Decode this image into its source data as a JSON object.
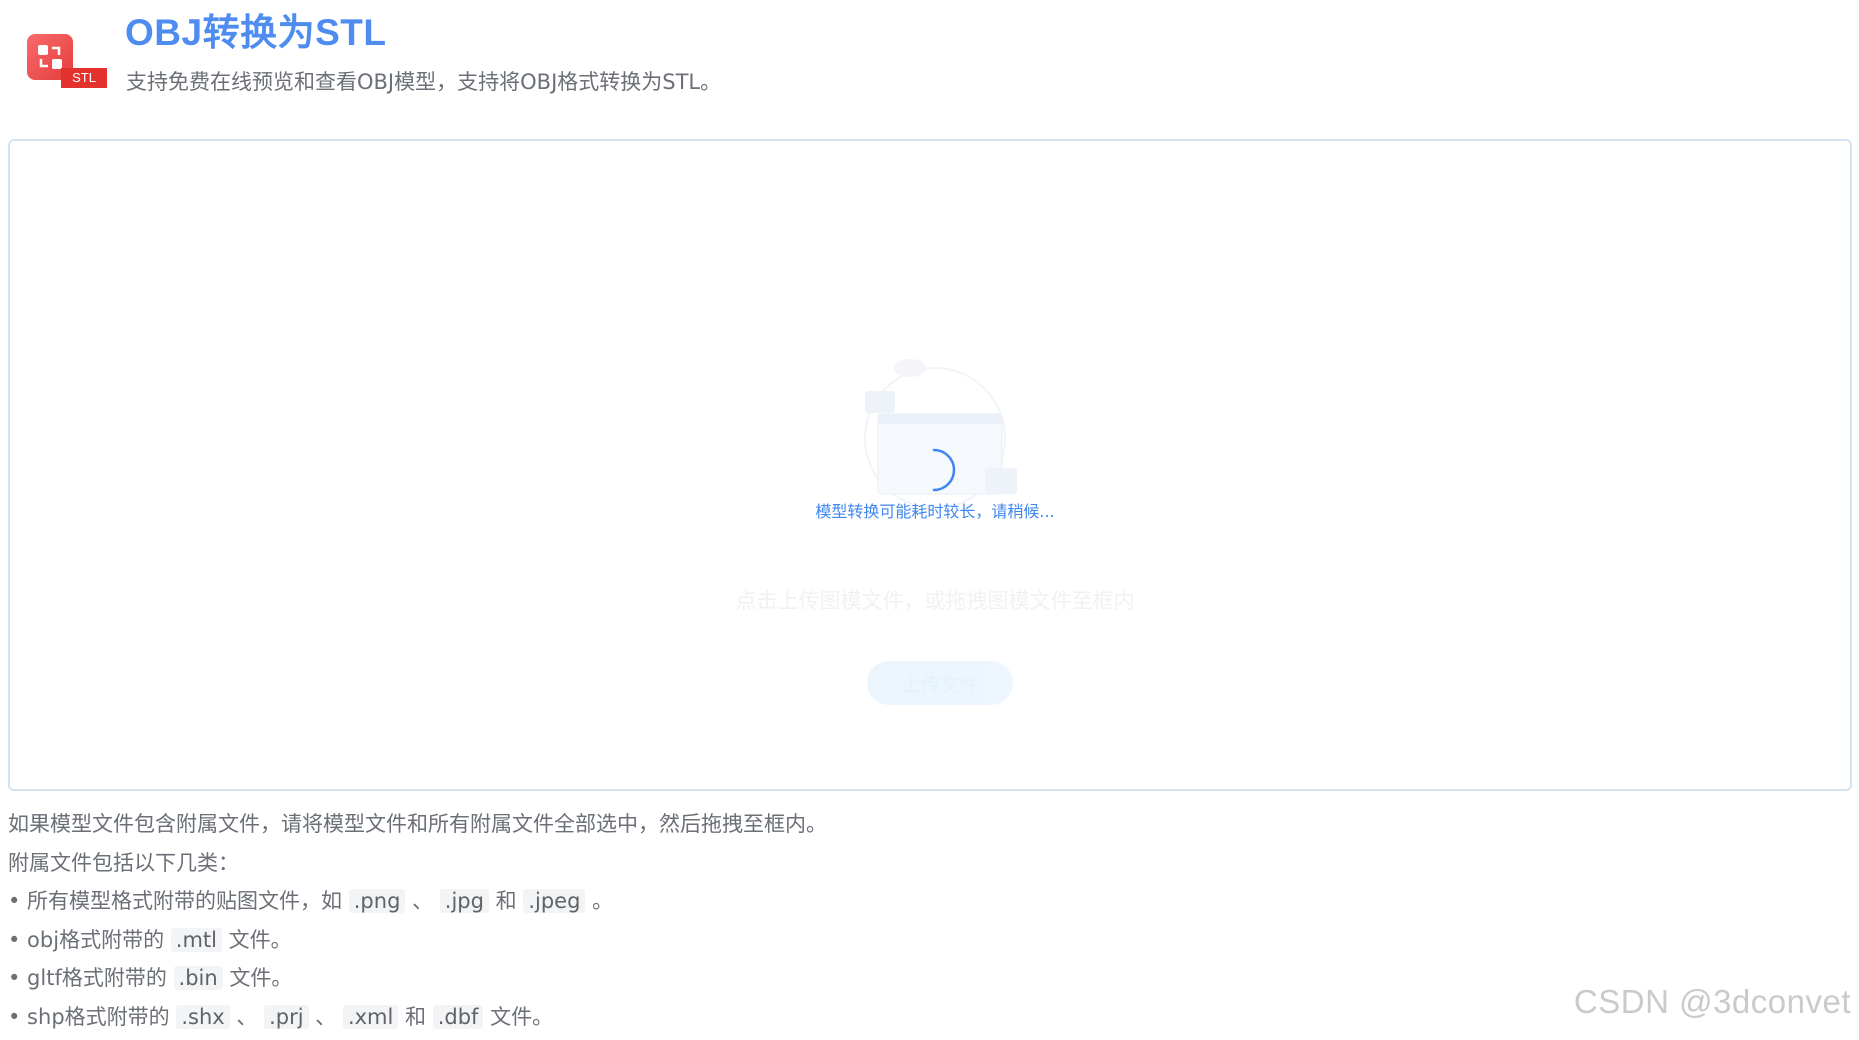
{
  "header": {
    "logo_tag": "STL",
    "title": "OBJ转换为STL",
    "subtitle": "支持免费在线预览和查看OBJ模型，支持将OBJ格式转换为STL。"
  },
  "upload": {
    "loading_text": "模型转换可能耗时较长，请稍候...",
    "hint": "点击上传图模文件，或拖拽图模文件至框内",
    "button_label": "上传文件"
  },
  "notes": {
    "line1": "如果模型文件包含附属文件，请将模型文件和所有附属文件全部选中，然后拖拽至框内。",
    "line2": "附属文件包括以下几类：",
    "item1": {
      "prefix": "• 所有模型格式附带的贴图文件，如",
      "ext1": ".png",
      "sep1": "、",
      "ext2": ".jpg",
      "sep2": "和",
      "ext3": ".jpeg",
      "suffix": "。"
    },
    "item2": {
      "prefix": "• obj格式附带的",
      "ext1": ".mtl",
      "suffix": "文件。"
    },
    "item3": {
      "prefix": "• gltf格式附带的",
      "ext1": ".bin",
      "suffix": "文件。"
    },
    "item4": {
      "prefix": "• shp格式附带的",
      "ext1": ".shx",
      "sep1": "、",
      "ext2": ".prj",
      "sep2": "、",
      "ext3": ".xml",
      "sep3": "和",
      "ext4": ".dbf",
      "suffix": "文件。"
    }
  },
  "watermark": "CSDN @3dconvet",
  "colors": {
    "title": "#4e8cf0",
    "logo": "#e3312d",
    "loading": "#3e86f0",
    "border": "#d6e4f2"
  }
}
